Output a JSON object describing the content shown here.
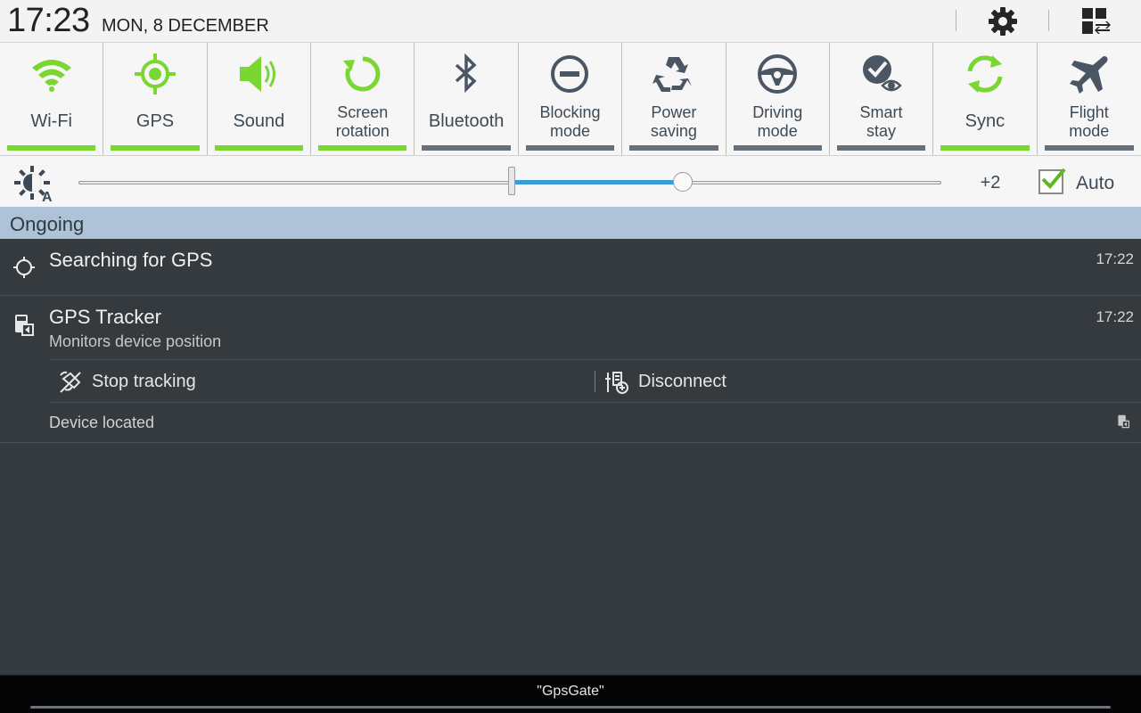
{
  "statusbar": {
    "time": "17:23",
    "date": "MON, 8 DECEMBER",
    "settings_icon": "gear-icon",
    "edit_icon": "toggle-edit-icon"
  },
  "toggles": [
    {
      "label": "Wi-Fi",
      "lines": 1,
      "on": true,
      "icon": "wifi-icon"
    },
    {
      "label": "GPS",
      "lines": 1,
      "on": true,
      "icon": "gps-icon"
    },
    {
      "label": "Sound",
      "lines": 1,
      "on": true,
      "icon": "sound-icon"
    },
    {
      "label": "Screen rotation",
      "line1": "Screen",
      "line2": "rotation",
      "lines": 2,
      "on": true,
      "icon": "rotation-icon"
    },
    {
      "label": "Bluetooth",
      "lines": 1,
      "on": false,
      "icon": "bluetooth-icon"
    },
    {
      "label": "Blocking mode",
      "line1": "Blocking",
      "line2": "mode",
      "lines": 2,
      "on": false,
      "icon": "blocking-icon"
    },
    {
      "label": "Power saving",
      "line1": "Power",
      "line2": "saving",
      "lines": 2,
      "on": false,
      "icon": "recycle-icon"
    },
    {
      "label": "Driving mode",
      "line1": "Driving",
      "line2": "mode",
      "lines": 2,
      "on": false,
      "icon": "steering-wheel-icon"
    },
    {
      "label": "Smart stay",
      "line1": "Smart",
      "line2": "stay",
      "lines": 2,
      "on": false,
      "icon": "smart-stay-icon"
    },
    {
      "label": "Sync",
      "lines": 1,
      "on": true,
      "icon": "sync-icon"
    },
    {
      "label": "Flight mode",
      "line1": "Flight",
      "line2": "mode",
      "lines": 2,
      "on": false,
      "icon": "airplane-icon"
    }
  ],
  "brightness": {
    "value_label": "+2",
    "level": 0.7,
    "auto_label": "Auto",
    "auto_checked": true
  },
  "section": {
    "title": "Ongoing"
  },
  "notifications": [
    {
      "title": "Searching for GPS",
      "time": "17:22",
      "icon": "crosshair-icon"
    },
    {
      "title": "GPS Tracker",
      "subtitle": "Monitors device position",
      "time": "17:22",
      "icon": "gps-tracker-icon",
      "actions": [
        {
          "label": "Stop tracking",
          "icon": "stop-tracking-icon"
        },
        {
          "label": "Disconnect",
          "icon": "disconnect-icon"
        }
      ],
      "footer": "Device located"
    }
  ],
  "bottombar": {
    "label": "\"GpsGate\""
  },
  "colors": {
    "on": "#7ad631",
    "off": "#66717c",
    "slider": "#3b9ad8",
    "header": "#aec3d8",
    "panel": "#353a3e"
  }
}
